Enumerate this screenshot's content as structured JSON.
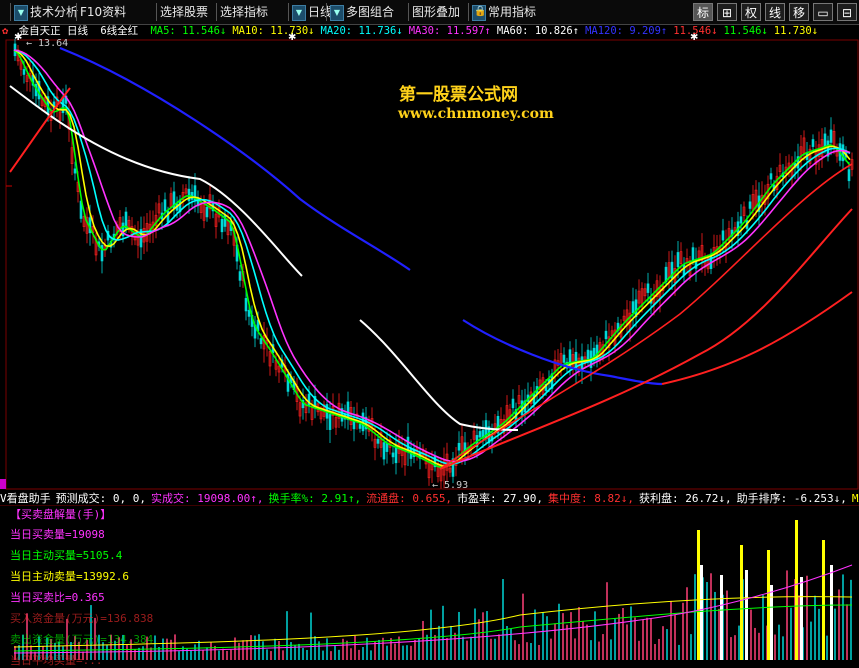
{
  "toolbar": {
    "items": [
      {
        "label": "技术分析",
        "has_menu": true
      },
      {
        "label": "F10资料",
        "has_menu": false
      },
      {
        "label": "选择股票",
        "has_menu": false
      },
      {
        "label": "选择指标",
        "has_menu": false
      },
      {
        "label": "日线",
        "has_menu": true
      },
      {
        "label": "多图组合",
        "has_menu": true
      },
      {
        "label": "图形叠加",
        "has_menu": false
      },
      {
        "label": "常用指标",
        "has_menu": true
      }
    ],
    "right_buttons": [
      {
        "label": "标",
        "active": true
      },
      {
        "label": "⊞",
        "active": false
      },
      {
        "label": "权",
        "active": false
      },
      {
        "label": "线",
        "active": false
      },
      {
        "label": "移",
        "active": false
      },
      {
        "label": "▭",
        "active": false
      },
      {
        "label": "⊟",
        "active": false
      }
    ]
  },
  "main_chart": {
    "stock_name": "金自天正",
    "period": "日线",
    "indicator_name": "6线全红",
    "ma_labels": [
      {
        "text": "MA5: 11.546↓",
        "color": "#00ff00"
      },
      {
        "text": "MA10: 11.730↓",
        "color": "#ffff00"
      },
      {
        "text": "MA20: 11.736↓",
        "color": "#00ffff"
      },
      {
        "text": "MA30: 11.597↑",
        "color": "#ff33ff"
      },
      {
        "text": "MA60: 10.826↑",
        "color": "#ffffff"
      },
      {
        "text": "MA120: 9.209↑",
        "color": "#3333ff"
      },
      {
        "text": "11.546↓",
        "color": "#ff3030"
      },
      {
        "text": "11.546↓",
        "color": "#00ff00"
      },
      {
        "text": "11.730↓",
        "color": "#ffff00"
      }
    ],
    "high_label": "13.64",
    "low_label": "5.93",
    "watermark_title": "第一股票公式网",
    "watermark_url": "www.chnmoney.com"
  },
  "sub_chart": {
    "header": [
      {
        "text": "V看盘助手",
        "color": "#ffffff"
      },
      {
        "text": "预测成交: 0, 0,",
        "color": "#ffffff"
      },
      {
        "text": "实成交: 19098.00↑,",
        "color": "#ff33ff"
      },
      {
        "text": "换手率%: 2.91↑,",
        "color": "#00ff00"
      },
      {
        "text": "流通盘: 0.655,",
        "color": "#ff3030"
      },
      {
        "text": "市盈率: 27.90,",
        "color": "#ffffff"
      },
      {
        "text": "集中度: 8.82↓,",
        "color": "#ff3030"
      },
      {
        "text": "获利盘: 26.72↓,",
        "color": "#ffffff"
      },
      {
        "text": "助手排序: -6.253↓,",
        "color": "#ffffff"
      },
      {
        "text": "MA",
        "color": "#ffff00"
      }
    ],
    "title": "【买卖盘解量(手)】",
    "lines": [
      {
        "text": "当日买卖量=19098",
        "color": "#ff33ff"
      },
      {
        "text": "当日主动买量=5105.4",
        "color": "#00ff00"
      },
      {
        "text": "当日主动卖量=13992.6",
        "color": "#ffff00"
      },
      {
        "text": "当日买卖比=0.365",
        "color": "#ff33ff"
      }
    ],
    "partial_lines": [
      {
        "text": "买入资金量(万元)=136.838",
        "color": "#ff3030"
      },
      {
        "text": "卖出资金量(万元)=134.384",
        "color": "#00ff00"
      },
      {
        "text": "当日平均买量=...",
        "color": "#ff3030"
      }
    ]
  },
  "colors": {
    "ma5": "#00ff00",
    "ma10": "#ffff00",
    "ma20": "#00ffff",
    "ma30": "#ff33ff",
    "ma60": "#ffffff",
    "ma120": "#2020ff",
    "up": "#ff2020",
    "down": "#00ffff"
  }
}
